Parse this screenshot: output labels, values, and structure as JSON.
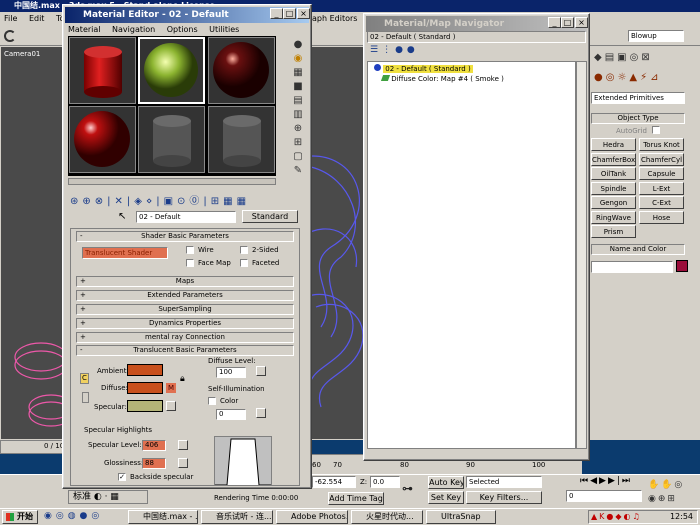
{
  "max": {
    "title": "中国结.max - 3ds max 5 - Stand-alone License",
    "menu": [
      "File",
      "Edit",
      "Tools"
    ],
    "menu_right": [
      "aph Editors"
    ],
    "viewport_label": "Camera01",
    "frame_counter": "0 / 10",
    "coord_value": "-62.554",
    "z_label": "Z:",
    "z_value": "0.0",
    "timeline_ticks": [
      "70",
      "80",
      "90",
      "100"
    ],
    "timeline_ticks_left": [
      "60"
    ],
    "rendering_time": "Rendering Time  0:00:00",
    "add_time_tag": "Add Time Tag",
    "auto_key": "Auto Key",
    "set_key": "Set Key",
    "selected": "Selected",
    "key_filters": "Key Filters...",
    "frame_field": "0",
    "ime_label": "标准"
  },
  "right_panel": {
    "blowup": "Blowup",
    "dropdown": "Extended Primitives",
    "rollout_object_type": "Object Type",
    "autogrid": "AutoGrid",
    "buttons": [
      "Hedra",
      "Torus Knot",
      "ChamferBox",
      "ChamferCyl",
      "OilTank",
      "Capsule",
      "Spindle",
      "L-Ext",
      "Gengon",
      "C-Ext",
      "RingWave",
      "Hose",
      "Prism"
    ],
    "rollout_name_color": "Name and Color",
    "name_color": "#9b0d3a"
  },
  "material_editor": {
    "title": "Material Editor - 02 - Default",
    "menu": [
      "Material",
      "Navigation",
      "Options",
      "Utilities"
    ],
    "material_name": "02 - Default",
    "material_type": "Standard",
    "rollouts": {
      "shader_basic": "Shader Basic Parameters",
      "shader_value": "Translucent Shader",
      "wire": "Wire",
      "two_sided": "2-Sided",
      "face_map": "Face Map",
      "faceted": "Faceted",
      "maps": "Maps",
      "extended": "Extended Parameters",
      "supersampling": "SuperSampling",
      "dynamics": "Dynamics Properties",
      "mental_ray": "mental ray Connection",
      "translucent": "Translucent Basic Parameters"
    },
    "ambient": "Ambient:",
    "diffuse": "Diffuse:",
    "specular": "Specular:",
    "lock_m": "M",
    "diffuse_level_label": "Diffuse Level:",
    "diffuse_level": "100",
    "self_illum_label": "Self-Illumination",
    "color_label": "Color",
    "self_illum_value": "0",
    "spec_highlights": "Specular Highlights",
    "spec_level_label": "Specular Level:",
    "spec_level": "406",
    "glossiness_label": "Glossiness:",
    "glossiness": "88",
    "backside": "Backside specular",
    "colors": {
      "ambient": "#c8501c",
      "diffuse": "#c8501c",
      "specular": "#b4b478"
    }
  },
  "navigator": {
    "title": "Material/Map Navigator",
    "field": "02 - Default  ( Standard )",
    "tree": [
      {
        "label": "02 - Default  ( Standard )",
        "selected": true
      },
      {
        "label": "Diffuse Color: Map #4  ( Smoke )",
        "selected": false
      }
    ]
  },
  "taskbar": {
    "start": "开始",
    "items": [
      "中国结.max - ...",
      "音乐试听 - 连...",
      "Adobe Photos...",
      "火星时代动...",
      "UltraSnap"
    ],
    "clock": "12:54"
  }
}
